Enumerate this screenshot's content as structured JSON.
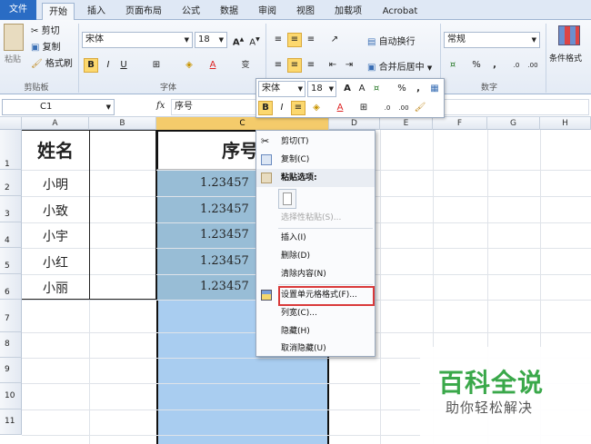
{
  "tabs": [
    "文件",
    "开始",
    "插入",
    "页面布局",
    "公式",
    "数据",
    "审阅",
    "视图",
    "加载项",
    "Acrobat"
  ],
  "ribbon": {
    "clipboard": {
      "paste": "粘贴",
      "cut": "剪切",
      "copy": "复制",
      "format_painter": "格式刷",
      "label": "剪贴板"
    },
    "font": {
      "name": "宋体",
      "size": "18",
      "label": "字体",
      "bold": "B",
      "italic": "I",
      "underline": "U",
      "phonetic": "变"
    },
    "alignment": {
      "wrap": "自动换行",
      "merge": "合并后居中"
    },
    "number": {
      "format": "常规",
      "label": "数字",
      "percent": "%",
      "comma": ","
    },
    "styles": {
      "conditional": "条件格式"
    }
  },
  "formula_bar": {
    "name_box": "C1",
    "fx": "fx",
    "content": "序号"
  },
  "columns": [
    "A",
    "B",
    "C",
    "D",
    "E",
    "F",
    "G",
    "H"
  ],
  "rows": [
    "1",
    "2",
    "3",
    "4",
    "5",
    "6",
    "7",
    "8",
    "9",
    "10",
    "11"
  ],
  "cells": {
    "A": [
      "姓名",
      "小明",
      "小致",
      "小宇",
      "小红",
      "小丽"
    ],
    "C": [
      "序号",
      "1.23457",
      "1.23457",
      "1.23457",
      "1.23457",
      "1.23457"
    ]
  },
  "mini_toolbar": {
    "font": "宋体",
    "size": "18",
    "percent": "%",
    "comma": ","
  },
  "context_menu": [
    {
      "label": "剪切(T)",
      "icon": "scissors-icon",
      "state": "normal"
    },
    {
      "label": "复制(C)",
      "icon": "copy-icon",
      "state": "normal"
    },
    {
      "label": "粘贴选项:",
      "icon": "paste-icon",
      "state": "header"
    },
    {
      "label": "",
      "icon": "paste-option-icon",
      "state": "option"
    },
    {
      "label": "选择性粘贴(S)...",
      "icon": "",
      "state": "disabled"
    },
    {
      "label": "插入(I)",
      "icon": "",
      "state": "normal"
    },
    {
      "label": "删除(D)",
      "icon": "",
      "state": "normal"
    },
    {
      "label": "清除内容(N)",
      "icon": "",
      "state": "normal"
    },
    {
      "label": "设置单元格格式(F)...",
      "icon": "format-cells-icon",
      "state": "highlighted"
    },
    {
      "label": "列宽(C)...",
      "icon": "",
      "state": "normal"
    },
    {
      "label": "隐藏(H)",
      "icon": "",
      "state": "normal"
    },
    {
      "label": "取消隐藏(U)",
      "icon": "",
      "state": "normal"
    }
  ],
  "watermark": {
    "title": "百科全说",
    "subtitle": "助你轻松解决"
  },
  "colors": {
    "accent": "#2a6cc4",
    "selection": "#a9cdf0",
    "highlight_box": "#d93a3a",
    "watermark": "#3aa84a"
  }
}
